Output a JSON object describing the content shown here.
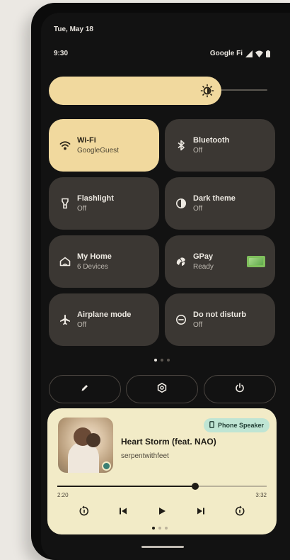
{
  "status_bar": {
    "date": "Tue, May 18",
    "time": "9:30",
    "carrier": "Google Fi"
  },
  "brightness": {
    "level": 0.7
  },
  "tiles": [
    {
      "name": "wifi",
      "label": "Wi-Fi",
      "status": "GoogleGuest",
      "active": true,
      "icon": "wifi-icon"
    },
    {
      "name": "bluetooth",
      "label": "Bluetooth",
      "status": "Off",
      "active": false,
      "icon": "bluetooth-icon"
    },
    {
      "name": "flashlight",
      "label": "Flashlight",
      "status": "Off",
      "active": false,
      "icon": "flashlight-icon"
    },
    {
      "name": "dark-theme",
      "label": "Dark theme",
      "status": "Off",
      "active": false,
      "icon": "dark-theme-icon"
    },
    {
      "name": "my-home",
      "label": "My Home",
      "status": "6 Devices",
      "active": false,
      "icon": "home-icon"
    },
    {
      "name": "gpay",
      "label": "GPay",
      "status": "Ready",
      "active": false,
      "icon": "gpay-icon"
    },
    {
      "name": "airplane-mode",
      "label": "Airplane mode",
      "status": "Off",
      "active": false,
      "icon": "airplane-icon"
    },
    {
      "name": "do-not-disturb",
      "label": "Do not disturb",
      "status": "Off",
      "active": false,
      "icon": "dnd-icon"
    }
  ],
  "page_indicator": {
    "count": 3,
    "current": 1
  },
  "actions": [
    {
      "name": "edit-button",
      "icon": "pencil-icon"
    },
    {
      "name": "settings-button",
      "icon": "gear-icon"
    },
    {
      "name": "power-button",
      "icon": "power-icon"
    }
  ],
  "media": {
    "output": "Phone Speaker",
    "song": "Heart Storm (feat. NAO)",
    "artist": "serpentwithfeet",
    "elapsed": "2:20",
    "total": "3:32",
    "progress": 0.66,
    "page_count": 3,
    "page_current": 1
  },
  "colors": {
    "accent": "#f1d99e",
    "tile": "#3b3733",
    "background": "#121212",
    "media_card": "#f2ebc7",
    "speaker_chip": "#bfe5d4"
  }
}
